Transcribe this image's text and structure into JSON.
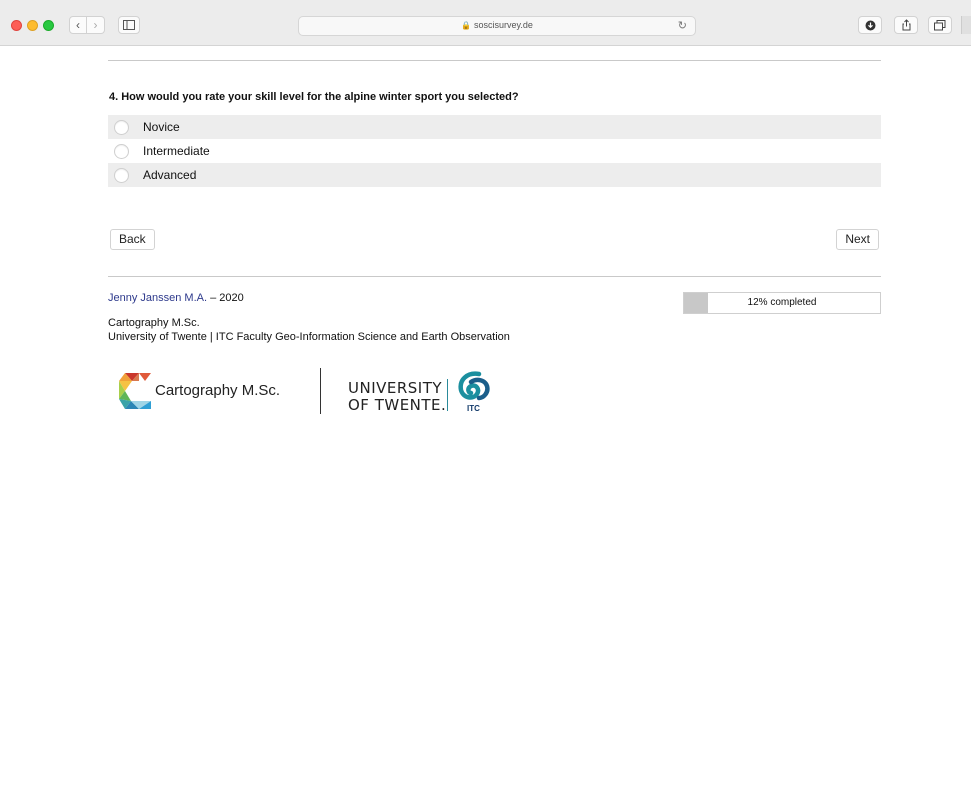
{
  "browser": {
    "url": "soscisurvey.de"
  },
  "survey": {
    "question": "4. How would you rate your skill level for the alpine winter sport you selected?",
    "options": [
      "Novice",
      "Intermediate",
      "Advanced"
    ],
    "back_label": "Back",
    "next_label": "Next",
    "progress_percent": 12,
    "progress_label": "12% completed"
  },
  "footer": {
    "author_name": "Jenny Janssen M.A.",
    "author_suffix": " – 2020",
    "program": "Cartography M.Sc.",
    "institution": "University of Twente | ITC Faculty Geo-Information Science and Earth Observation",
    "logo_carto_text": "Cartography M.Sc.",
    "logo_ut_line1": "UNIVERSITY",
    "logo_ut_line2": "OF TWENTE.",
    "logo_itc_text": "ITC"
  },
  "colors": {
    "author_link": "#2e3a8c",
    "progress_fill": "#c8c8c8",
    "option_shade": "#ededed"
  }
}
